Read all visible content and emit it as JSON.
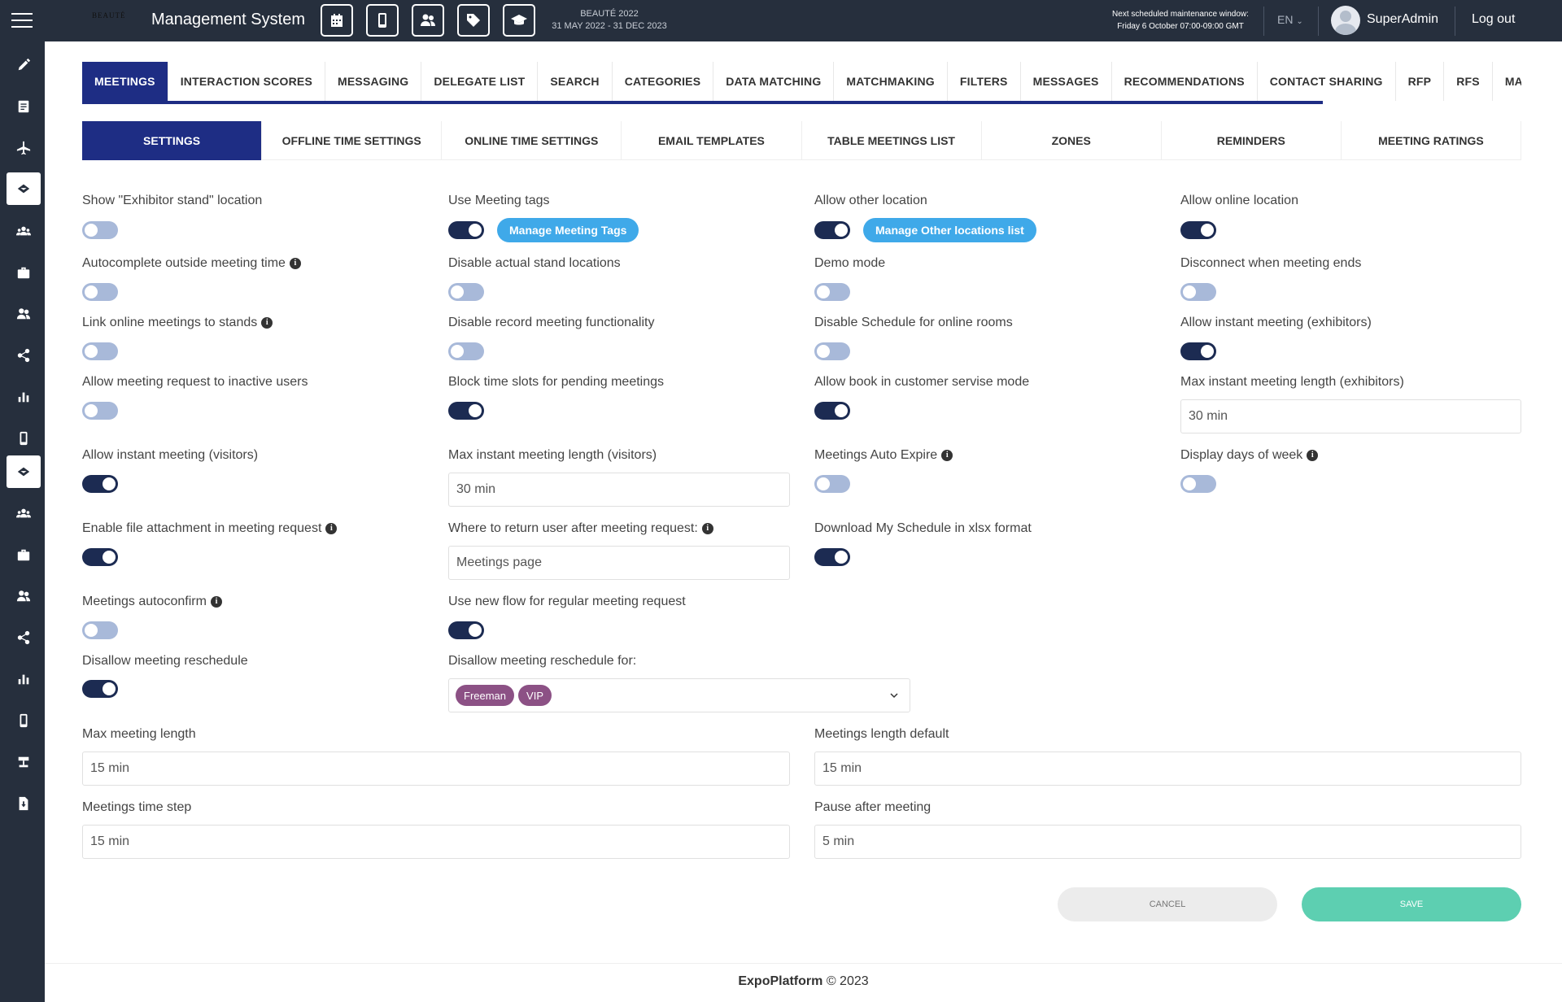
{
  "app": {
    "brand": "BEAUTÉ",
    "title": "Management System",
    "event_name": "BEAUTÉ 2022",
    "event_dates": "31 MAY 2022 - 31 DEC 2023",
    "maintenance_label": "Next scheduled maintenance window:",
    "maintenance_time": "Friday 6 October 07:00-09:00 GMT",
    "language": "EN",
    "username": "SuperAdmin",
    "logout": "Log out"
  },
  "top_icons": [
    "calendar-icon",
    "mobile-icon",
    "users-icon",
    "tag-icon",
    "graduation-cap-icon"
  ],
  "sidebar_icons": [
    "pencil-icon",
    "document-icon",
    "plane-icon",
    "handshake-icon",
    "group-icon",
    "briefcase-icon",
    "users-icon",
    "share-icon",
    "bar-chart-icon",
    "mobile-icon",
    "handshake-icon",
    "group-icon",
    "briefcase-icon",
    "users-icon",
    "share-icon",
    "bar-chart-icon",
    "mobile-icon",
    "stand-icon",
    "file-export-icon"
  ],
  "main_tabs": [
    "MEETINGS",
    "INTERACTION SCORES",
    "MESSAGING",
    "DELEGATE LIST",
    "SEARCH",
    "CATEGORIES",
    "DATA MATCHING",
    "MATCHMAKING",
    "FILTERS",
    "MESSAGES",
    "RECOMMENDATIONS",
    "CONTACT SHARING",
    "RFP",
    "RFS",
    "MANAGE PER"
  ],
  "sub_tabs": [
    "SETTINGS",
    "OFFLINE TIME SETTINGS",
    "ONLINE TIME SETTINGS",
    "EMAIL TEMPLATES",
    "TABLE MEETINGS LIST",
    "ZONES",
    "REMINDERS",
    "MEETING RATINGS"
  ],
  "settings": {
    "show_exhibitor_stand": {
      "label": "Show \"Exhibitor stand\" location",
      "on": false
    },
    "use_meeting_tags": {
      "label": "Use Meeting tags",
      "on": true,
      "button": "Manage Meeting Tags"
    },
    "allow_other_location": {
      "label": "Allow other location",
      "on": true,
      "button": "Manage Other locations list"
    },
    "allow_online_location": {
      "label": "Allow online location",
      "on": true
    },
    "autocomplete_outside": {
      "label": "Autocomplete outside meeting time",
      "on": false
    },
    "disable_stand_locations": {
      "label": "Disable actual stand locations",
      "on": false
    },
    "demo_mode": {
      "label": "Demo mode",
      "on": false
    },
    "disconnect_when_ends": {
      "label": "Disconnect when meeting ends",
      "on": false
    },
    "link_online_meetings": {
      "label": "Link online meetings to stands",
      "on": false
    },
    "disable_record": {
      "label": "Disable record meeting functionality",
      "on": false
    },
    "disable_schedule_online": {
      "label": "Disable Schedule for online rooms",
      "on": false
    },
    "allow_instant_exhibitors": {
      "label": "Allow instant meeting (exhibitors)",
      "on": true
    },
    "allow_request_inactive": {
      "label": "Allow meeting request to inactive users",
      "on": false
    },
    "block_time_slots": {
      "label": "Block time slots for pending meetings",
      "on": true
    },
    "allow_book_customer": {
      "label": "Allow book in customer servise mode",
      "on": true
    },
    "max_instant_exhibitors": {
      "label": "Max instant meeting length (exhibitors)",
      "value": "30 min"
    },
    "allow_instant_visitors": {
      "label": "Allow instant meeting (visitors)",
      "on": true
    },
    "max_instant_visitors": {
      "label": "Max instant meeting length (visitors)",
      "value": "30 min"
    },
    "meetings_auto_expire": {
      "label": "Meetings Auto Expire",
      "on": false
    },
    "display_days_of_week": {
      "label": "Display days of week",
      "on": false
    },
    "enable_file_attachment": {
      "label": "Enable file attachment in meeting request",
      "on": true
    },
    "return_user_after": {
      "label": "Where to return user after meeting request:",
      "value": "Meetings page"
    },
    "download_schedule_xlsx": {
      "label": "Download My Schedule in xlsx format",
      "on": true
    },
    "meetings_autoconfirm": {
      "label": "Meetings autoconfirm",
      "on": false
    },
    "use_new_flow": {
      "label": "Use new flow for regular meeting request",
      "on": true
    },
    "disallow_reschedule": {
      "label": "Disallow meeting reschedule",
      "on": true
    },
    "disallow_reschedule_for": {
      "label": "Disallow meeting reschedule for:",
      "tags": [
        "Freeman",
        "VIP"
      ]
    },
    "max_meeting_length": {
      "label": "Max meeting length",
      "value": "15 min"
    },
    "meetings_length_default": {
      "label": "Meetings length default",
      "value": "15 min"
    },
    "meetings_time_step": {
      "label": "Meetings time step",
      "value": "15 min"
    },
    "pause_after_meeting": {
      "label": "Pause after meeting",
      "value": "5 min"
    }
  },
  "actions": {
    "cancel": "CANCEL",
    "save": "SAVE"
  },
  "footer": {
    "brand": "ExpoPlatform",
    "copyright": "© 2023"
  },
  "colors": {
    "topbar": "#262f3d",
    "accent": "#1e2d84",
    "toggle_on": "#1c2b52",
    "toggle_off": "#a8b9d9",
    "pill": "#3fa9e9",
    "tag": "#8c5185",
    "save": "#5dcfb1"
  }
}
